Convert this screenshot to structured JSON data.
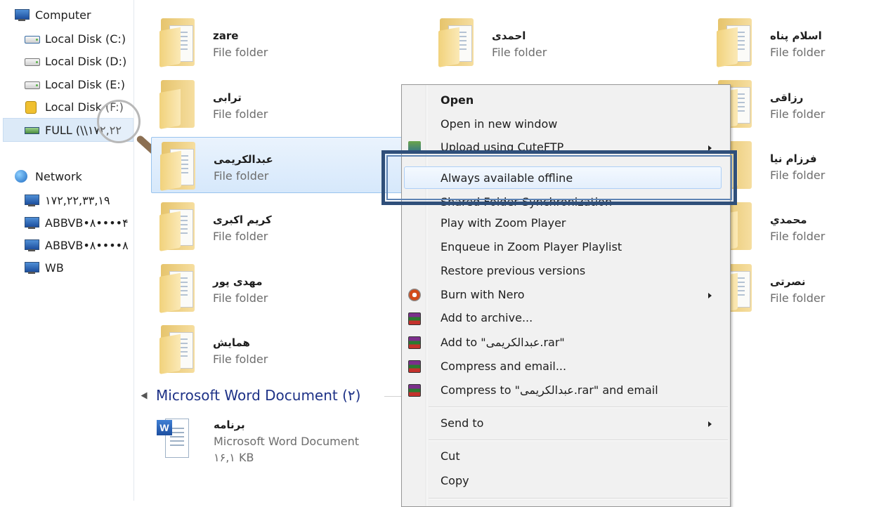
{
  "nav": {
    "computer": "Computer",
    "drives": [
      {
        "label": "Local Disk (C:)",
        "icon": "windows-disk-icon"
      },
      {
        "label": "Local Disk (D:)",
        "icon": "disk-icon"
      },
      {
        "label": "Local Disk (E:)",
        "icon": "disk-icon"
      },
      {
        "label": "Local Disk (F:)",
        "icon": "locked-disk-icon"
      },
      {
        "label": "FULL (\\\\۱۷۲,۲۲",
        "icon": "network-drive-icon"
      }
    ],
    "network": "Network",
    "hosts": [
      "۱۷۲,۲۲,۳۳,۱۹",
      "ABBVB•۸••••۴",
      "ABBVB•۸••••۸",
      "WB"
    ]
  },
  "folders": {
    "col1": [
      {
        "name": "zare",
        "type": "File folder"
      },
      {
        "name": "ترابی",
        "type": "File folder"
      },
      {
        "name": "عبدالکریمی",
        "type": "File folder"
      },
      {
        "name": "کریم اکبری",
        "type": "File folder"
      },
      {
        "name": "مهدی پور",
        "type": "File folder"
      },
      {
        "name": "همایش",
        "type": "File folder"
      }
    ],
    "col2": [
      {
        "name": "احمدی",
        "type": "File folder"
      }
    ],
    "col3": [
      {
        "name": "اسلام پناه",
        "type": "File folder"
      },
      {
        "name": "رزاقی",
        "type": "File folder"
      },
      {
        "name": "فرزام نیا",
        "type": "File folder"
      },
      {
        "name": "محمدي",
        "type": "File folder"
      },
      {
        "name": "نصرتی",
        "type": "File folder"
      }
    ]
  },
  "group": {
    "title": "Microsoft Word Document (۲)"
  },
  "document": {
    "name": "برنامه",
    "type": "Microsoft Word Document",
    "size": "۱۶,۱ KB"
  },
  "menu": {
    "open": "Open",
    "open_new_window": "Open in new window",
    "upload_cuteftp": "Upload using CuteFTP",
    "always_offline": "Always available offline",
    "shared_sync": "Shared Folder Synchronization",
    "play_zoom": "Play with Zoom Player",
    "enqueue_zoom": "Enqueue in Zoom Player Playlist",
    "restore_versions": "Restore previous versions",
    "burn_nero": "Burn with Nero",
    "add_archive": "Add to archive...",
    "add_to_rar": "Add to \"عبدالکریمی.rar\"",
    "compress_email": "Compress and email...",
    "compress_to_rar_email": "Compress to \"عبدالکریمی.rar\" and email",
    "send_to": "Send to",
    "cut": "Cut",
    "copy": "Copy"
  },
  "colors": {
    "selection": "#dceaf8",
    "highlight_frame": "#2f4f7a",
    "menu_bg": "#f1f1f1",
    "group_header": "#1e3287"
  }
}
